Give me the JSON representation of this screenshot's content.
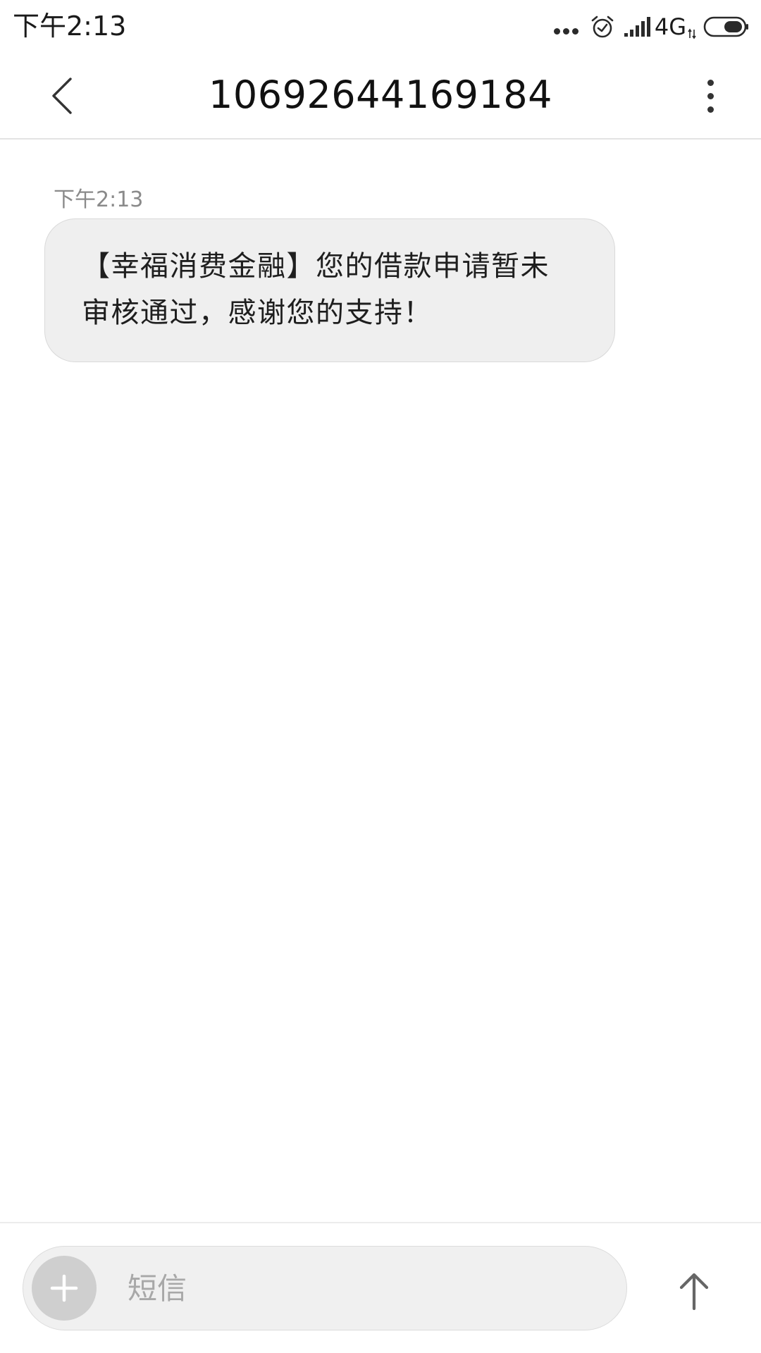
{
  "status_bar": {
    "time": "下午2:13",
    "network": "4G",
    "icons": [
      "more-dots-icon",
      "alarm-clock-icon",
      "signal-bars-icon",
      "data-arrows-icon",
      "battery-icon"
    ]
  },
  "app_bar": {
    "title": "10692644169184",
    "back_icon": "chevron-left-icon",
    "more_icon": "more-vertical-icon"
  },
  "conversation": {
    "messages": [
      {
        "time": "下午2:13",
        "text": "【幸福消费金融】您的借款申请暂未审核通过，感谢您的支持！",
        "direction": "incoming"
      }
    ]
  },
  "compose": {
    "placeholder": "短信",
    "attach_icon": "plus-icon",
    "send_icon": "arrow-up-icon"
  },
  "colors": {
    "bubble_background": "#efefef",
    "timestamp_text": "#8a8a8a",
    "attach_button": "#cfcfcf",
    "send_arrow": "#666666"
  }
}
